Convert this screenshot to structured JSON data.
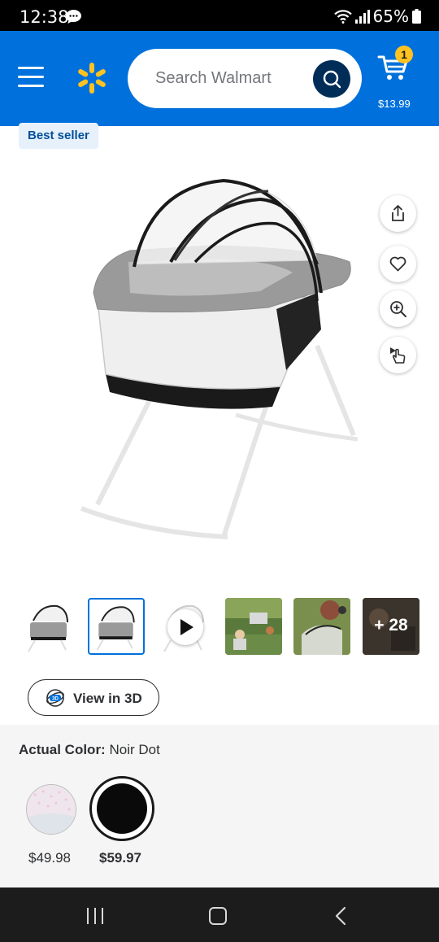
{
  "status_bar": {
    "time": "12:38",
    "battery_percent": "65%",
    "icons": [
      "message-icon",
      "wifi-icon",
      "signal-icon",
      "battery-icon"
    ]
  },
  "header": {
    "menu_icon": "hamburger-menu-icon",
    "logo_icon": "walmart-spark-icon",
    "search_placeholder": "Search Walmart",
    "search_icon": "search-icon",
    "cart": {
      "icon": "cart-icon",
      "count": "1",
      "total": "$13.99"
    }
  },
  "product": {
    "badge": "Best seller",
    "image": "bassinet-product-image",
    "actions": [
      "share-icon",
      "heart-icon",
      "zoom-in-icon",
      "hand-pointer-icon"
    ],
    "thumbnails": {
      "selected_index": 1,
      "more_count": "+ 28"
    },
    "view_3d_label": "View in 3D"
  },
  "variants": {
    "color_label": "Actual Color:",
    "color_value": "Noir Dot",
    "options": [
      {
        "name": "pink",
        "price": "$49.98",
        "selected": false
      },
      {
        "name": "noir-dot",
        "price": "$59.97",
        "selected": true
      }
    ]
  },
  "colors": {
    "brand_blue": "#0071dc",
    "dark_blue": "#002d58",
    "spark_yellow": "#ffc220",
    "text_dark": "#2e2f32"
  }
}
